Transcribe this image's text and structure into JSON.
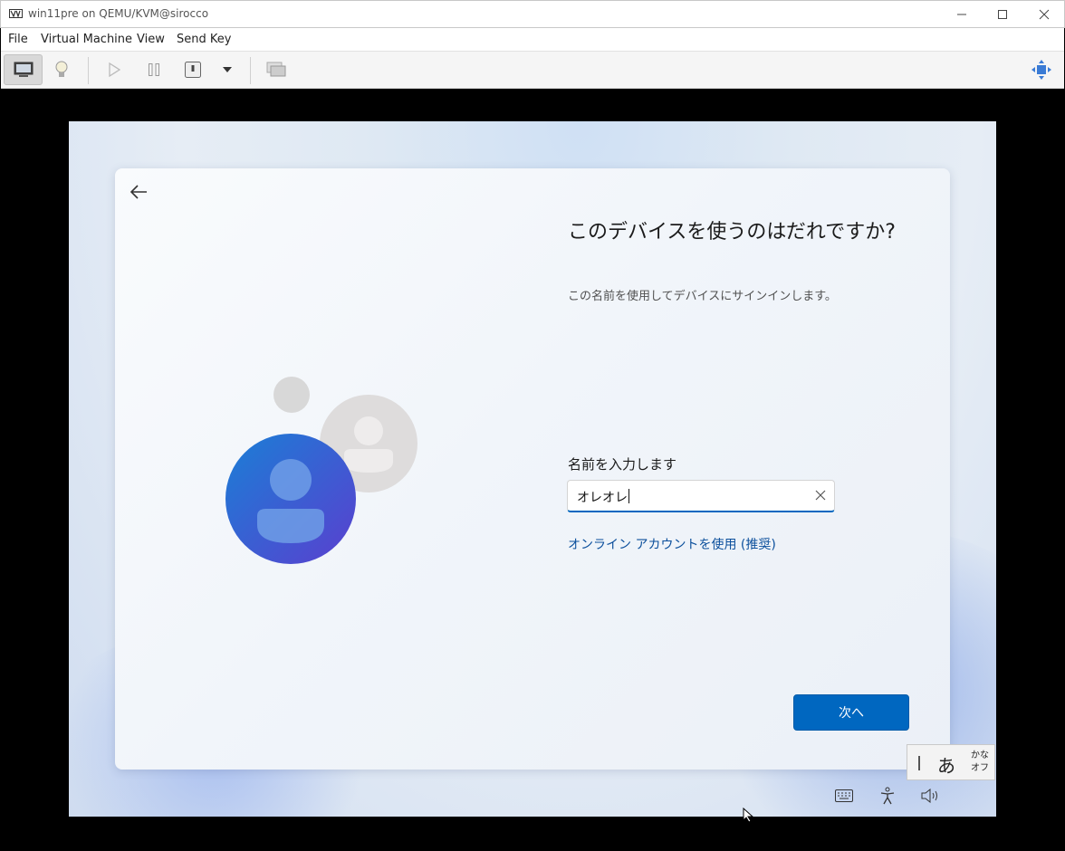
{
  "window": {
    "title": "win11pre on QEMU/KVM@sirocco",
    "controls": [
      "minimize",
      "maximize",
      "close"
    ]
  },
  "menu": {
    "file": "File",
    "virtual_machine": "Virtual Machine",
    "view": "View",
    "send_key": "Send Key"
  },
  "toolbar": {
    "icons": [
      "monitor-icon",
      "lightbulb-icon",
      "play-icon",
      "pause-icon",
      "power-icon",
      "dropdown-arrow-icon",
      "snapshot-icon",
      "fullscreen-icon"
    ]
  },
  "oobe": {
    "heading": "このデバイスを使うのはだれですか?",
    "subtitle": "この名前を使用してデバイスにサインインします。",
    "name_label": "名前を入力します",
    "name_value": "オレオレ",
    "online_account_link": "オンライン アカウントを使用 (推奨)",
    "next_button": "次へ",
    "accent_color": "#0067c0"
  },
  "ime": {
    "mode_char": "あ",
    "kana_line1": "かな",
    "kana_line2": "オフ"
  }
}
